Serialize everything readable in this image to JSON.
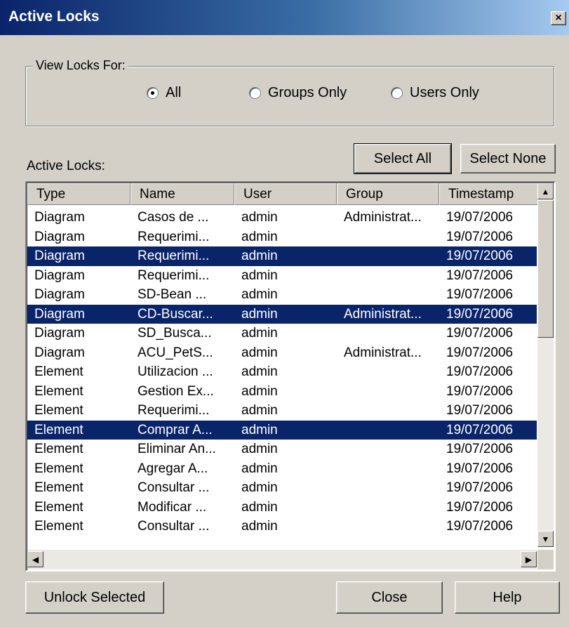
{
  "window": {
    "title": "Active Locks",
    "close_glyph": "×"
  },
  "view_locks": {
    "label": "View Locks For:",
    "options": [
      {
        "label": "All",
        "selected": true
      },
      {
        "label": "Groups Only",
        "selected": false
      },
      {
        "label": "Users Only",
        "selected": false
      }
    ]
  },
  "toolbar": {
    "select_all": "Select All",
    "select_none": "Select None"
  },
  "list": {
    "label": "Active Locks:",
    "columns": [
      "Type",
      "Name",
      "User",
      "Group",
      "Timestamp"
    ],
    "rows": [
      {
        "type": "Diagram",
        "name": "Casos de ...",
        "user": "admin",
        "group": "Administrat...",
        "timestamp": "19/07/2006",
        "selected": false
      },
      {
        "type": "Diagram",
        "name": "Requerimi...",
        "user": "admin",
        "group": "",
        "timestamp": "19/07/2006",
        "selected": false
      },
      {
        "type": "Diagram",
        "name": "Requerimi...",
        "user": "admin",
        "group": "",
        "timestamp": "19/07/2006",
        "selected": true
      },
      {
        "type": "Diagram",
        "name": "Requerimi...",
        "user": "admin",
        "group": "",
        "timestamp": "19/07/2006",
        "selected": false
      },
      {
        "type": "Diagram",
        "name": "SD-Bean ...",
        "user": "admin",
        "group": "",
        "timestamp": "19/07/2006",
        "selected": false
      },
      {
        "type": "Diagram",
        "name": "CD-Buscar...",
        "user": "admin",
        "group": "Administrat...",
        "timestamp": "19/07/2006",
        "selected": true
      },
      {
        "type": "Diagram",
        "name": "SD_Busca...",
        "user": "admin",
        "group": "",
        "timestamp": "19/07/2006",
        "selected": false
      },
      {
        "type": "Diagram",
        "name": "ACU_PetS...",
        "user": "admin",
        "group": "Administrat...",
        "timestamp": "19/07/2006",
        "selected": false
      },
      {
        "type": "Element",
        "name": "Utilizacion ...",
        "user": "admin",
        "group": "",
        "timestamp": "19/07/2006",
        "selected": false
      },
      {
        "type": "Element",
        "name": "Gestion Ex...",
        "user": "admin",
        "group": "",
        "timestamp": "19/07/2006",
        "selected": false
      },
      {
        "type": "Element",
        "name": "Requerimi...",
        "user": "admin",
        "group": "",
        "timestamp": "19/07/2006",
        "selected": false
      },
      {
        "type": "Element",
        "name": "Comprar A...",
        "user": "admin",
        "group": "",
        "timestamp": "19/07/2006",
        "selected": true
      },
      {
        "type": "Element",
        "name": "Eliminar An...",
        "user": "admin",
        "group": "",
        "timestamp": "19/07/2006",
        "selected": false
      },
      {
        "type": "Element",
        "name": "Agregar A...",
        "user": "admin",
        "group": "",
        "timestamp": "19/07/2006",
        "selected": false
      },
      {
        "type": "Element",
        "name": "Consultar ...",
        "user": "admin",
        "group": "",
        "timestamp": "19/07/2006",
        "selected": false
      },
      {
        "type": "Element",
        "name": "Modificar ...",
        "user": "admin",
        "group": "",
        "timestamp": "19/07/2006",
        "selected": false
      },
      {
        "type": "Element",
        "name": "Consultar ...",
        "user": "admin",
        "group": "",
        "timestamp": "19/07/2006",
        "selected": false
      }
    ]
  },
  "footer": {
    "unlock": "Unlock Selected",
    "close": "Close",
    "help": "Help"
  }
}
